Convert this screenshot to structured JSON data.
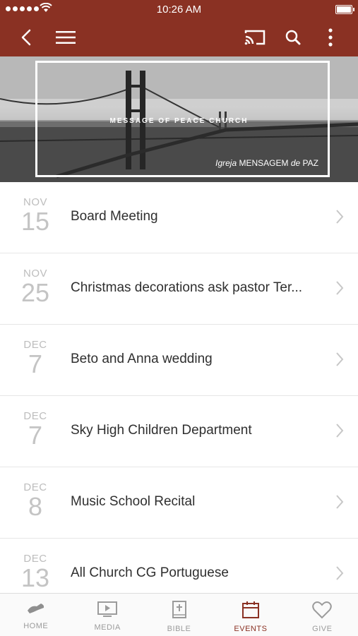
{
  "status": {
    "time": "10:26 AM"
  },
  "nav": {
    "icons": [
      "back-icon",
      "menu-icon",
      "cast-icon",
      "search-icon",
      "more-icon"
    ]
  },
  "hero": {
    "title": "MESSAGE OF PEACE CHURCH",
    "subtitle_italic_1": "Igreja",
    "subtitle_regular_1": "MENSAGEM",
    "subtitle_italic_2": "de",
    "subtitle_regular_2": "PAZ"
  },
  "events": [
    {
      "month": "NOV",
      "day": "15",
      "title": "Board Meeting"
    },
    {
      "month": "NOV",
      "day": "25",
      "title": "Christmas decorations ask pastor Ter..."
    },
    {
      "month": "DEC",
      "day": "7",
      "title": "Beto and Anna wedding"
    },
    {
      "month": "DEC",
      "day": "7",
      "title": "Sky High Children Department"
    },
    {
      "month": "DEC",
      "day": "8",
      "title": "Music School Recital"
    },
    {
      "month": "DEC",
      "day": "13",
      "title": "All Church CG Portuguese"
    }
  ],
  "tabs": [
    {
      "label": "HOME",
      "icon": "home-icon"
    },
    {
      "label": "MEDIA",
      "icon": "media-icon"
    },
    {
      "label": "BIBLE",
      "icon": "bible-icon"
    },
    {
      "label": "EVENTS",
      "icon": "calendar-icon",
      "active": true
    },
    {
      "label": "GIVE",
      "icon": "heart-icon"
    }
  ],
  "colors": {
    "brand": "#8a3123",
    "inactive": "#9b9b9b"
  }
}
